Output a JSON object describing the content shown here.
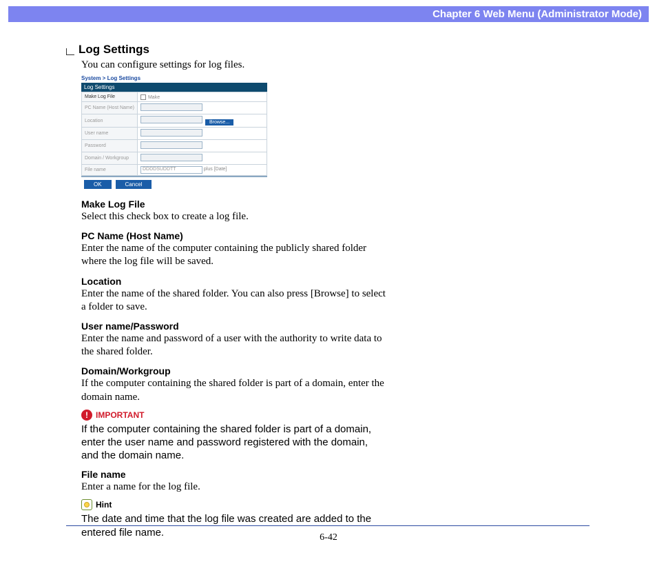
{
  "header": "Chapter 6   Web Menu (Administrator Mode)",
  "section": {
    "title": "Log Settings",
    "intro": "You can configure settings for log files."
  },
  "screenshot": {
    "breadcrumb": "System > Log Settings",
    "panel_title": "Log Settings",
    "rows": {
      "make": {
        "label": "Make Log File",
        "checkbox_label": "Make"
      },
      "pcname": {
        "label": "PC Name (Host Name)"
      },
      "location": {
        "label": "Location",
        "browse": "Browse..."
      },
      "username": {
        "label": "User name"
      },
      "password": {
        "label": "Password"
      },
      "domain": {
        "label": "Domain / Workgroup"
      },
      "filename": {
        "label": "File name",
        "value": "DDDDSUDDTT",
        "suffix": "plus [Date]"
      }
    },
    "buttons": {
      "ok": "OK",
      "cancel": "Cancel"
    }
  },
  "fields": {
    "make": {
      "title": "Make Log File",
      "text": "Select this check box to create a log file."
    },
    "pcname": {
      "title": "PC Name (Host Name)",
      "text": "Enter the name of the computer containing the publicly shared folder where the log file will be saved."
    },
    "location": {
      "title": "Location",
      "text": "Enter the name of the shared folder. You can also press [Browse] to select a folder to save."
    },
    "userpass": {
      "title": "User name/Password",
      "text": "Enter the name and password of a user with the authority to write data to the shared folder."
    },
    "domain": {
      "title": "Domain/Workgroup",
      "text": "If the computer containing the shared folder is part of a domain, enter the domain name."
    },
    "filename": {
      "title": "File name",
      "text": "Enter a name for the log file."
    }
  },
  "important": {
    "label": "IMPORTANT",
    "text": "If the computer containing the shared folder is part of a domain, enter the user name and password registered with the domain, and the domain name."
  },
  "hint": {
    "label": "Hint",
    "text": "The date and time that the log file was created are added to the entered file name."
  },
  "page_number": "6-42"
}
